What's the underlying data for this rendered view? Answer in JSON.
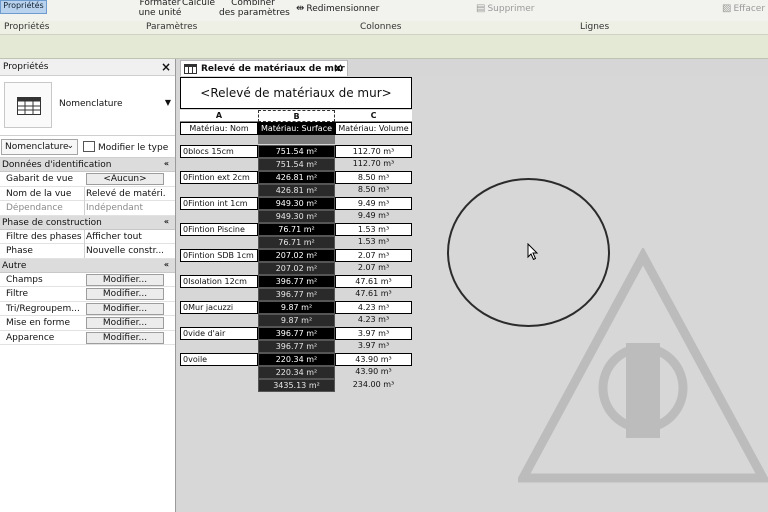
{
  "ribbon": {
    "properties_button": "Propriétés",
    "format_unit": "Formater\nune unité",
    "calculate": "Calculé",
    "combine_params": "Combiner\ndes paramètres",
    "resize": "Redimensionner",
    "delete": "Supprimer",
    "clear": "Effacer",
    "panels": [
      "Propriétés",
      "Paramètres",
      "Colonnes",
      "Lignes"
    ]
  },
  "properties": {
    "title": "Propriétés",
    "type_name": "Nomenclature",
    "filter_value": "Nomenclature",
    "edit_type_label": "Modifier le type",
    "groups": {
      "identification": {
        "label": "Données d'identification",
        "rows": [
          {
            "name": "Gabarit de vue",
            "value": "<Aucun>",
            "kind": "button"
          },
          {
            "name": "Nom de la vue",
            "value": "Relevé de matéri...",
            "kind": "text"
          },
          {
            "name": "Dépendance",
            "value": "Indépendant",
            "kind": "dim"
          }
        ]
      },
      "phase": {
        "label": "Phase de construction",
        "rows": [
          {
            "name": "Filtre des phases",
            "value": "Afficher tout",
            "kind": "text"
          },
          {
            "name": "Phase",
            "value": "Nouvelle constr...",
            "kind": "text"
          }
        ]
      },
      "other": {
        "label": "Autre",
        "rows": [
          {
            "name": "Champs",
            "value": "Modifier...",
            "kind": "button"
          },
          {
            "name": "Filtre",
            "value": "Modifier...",
            "kind": "button"
          },
          {
            "name": "Tri/Regroupem...",
            "value": "Modifier...",
            "kind": "button"
          },
          {
            "name": "Mise en forme",
            "value": "Modifier...",
            "kind": "button"
          },
          {
            "name": "Apparence",
            "value": "Modifier...",
            "kind": "button"
          }
        ]
      }
    }
  },
  "view_tab": {
    "label": "Relevé de matériaux de mur"
  },
  "schedule": {
    "title": "<Relevé de matériaux de mur>",
    "columns": [
      "A",
      "B",
      "C"
    ],
    "fields": [
      "Matériau: Nom",
      "Matériau: Surface",
      "Matériau: Volume"
    ],
    "groups": [
      {
        "name": "0blocs 15cm",
        "surface": "751.54 m²",
        "volume": "112.70 m³"
      },
      {
        "name": "0Fintion ext 2cm",
        "surface": "426.81 m²",
        "volume": "8.50 m³"
      },
      {
        "name": "0Fintion int 1cm",
        "surface": "949.30 m²",
        "volume": "9.49 m³"
      },
      {
        "name": "0Fintion Piscine",
        "surface": "76.71 m²",
        "volume": "1.53 m³"
      },
      {
        "name": "0Fintion SDB 1cm",
        "surface": "207.02 m²",
        "volume": "2.07 m³"
      },
      {
        "name": "0Isolation 12cm",
        "surface": "396.77 m²",
        "volume": "47.61 m³"
      },
      {
        "name": "0Mur jacuzzi",
        "surface": "9.87 m²",
        "volume": "4.23 m³"
      },
      {
        "name": "0vide d'air",
        "surface": "396.77 m²",
        "volume": "3.97 m³"
      },
      {
        "name": "0voile",
        "surface": "220.34 m²",
        "volume": "43.90 m³"
      }
    ],
    "grand_total": {
      "surface": "3435.13 m²",
      "volume": "234.00 m³"
    }
  }
}
